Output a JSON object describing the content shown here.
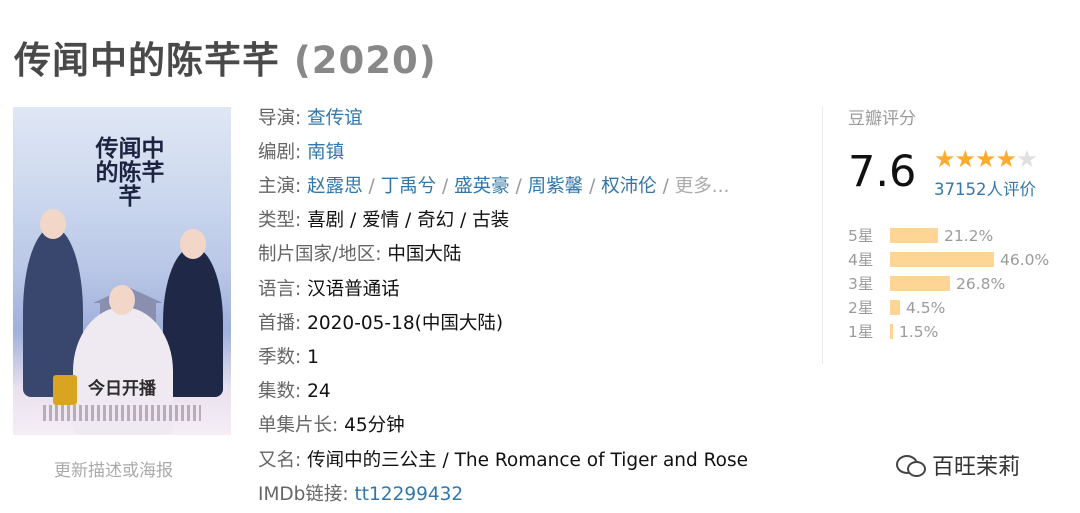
{
  "title": "传闻中的陈芊芊",
  "year": "(2020)",
  "poster": {
    "title_text": "传闻中的陈芊芊",
    "banner": "今日开播",
    "update_link": "更新描述或海报"
  },
  "info": {
    "director": {
      "label": "导演: ",
      "value": "查传谊"
    },
    "writer": {
      "label": "编剧: ",
      "value": "南镇"
    },
    "cast": {
      "label": "主演: ",
      "names": [
        "赵露思",
        "丁禹兮",
        "盛英豪",
        "周紫馨",
        "权沛伦"
      ],
      "more": "更多..."
    },
    "genre": {
      "label": "类型: ",
      "value": "喜剧 / 爱情 / 奇幻 / 古装"
    },
    "country": {
      "label": "制片国家/地区: ",
      "value": "中国大陆"
    },
    "language": {
      "label": "语言: ",
      "value": "汉语普通话"
    },
    "premiere": {
      "label": "首播: ",
      "value": "2020-05-18(中国大陆)"
    },
    "seasons": {
      "label": "季数: ",
      "value": "1"
    },
    "episodes": {
      "label": "集数: ",
      "value": "24"
    },
    "runtime": {
      "label": "单集片长: ",
      "value": "45分钟"
    },
    "aka": {
      "label": "又名: ",
      "value": "传闻中的三公主 / The Romance of Tiger and Rose"
    },
    "imdb": {
      "label": "IMDb链接: ",
      "value": "tt12299432"
    }
  },
  "rating": {
    "header": "豆瓣评分",
    "score": "7.6",
    "stars_filled": 4,
    "stars_total": 5,
    "votes": "37152人评价",
    "distribution": [
      {
        "label": "5星",
        "percent": 21.2,
        "text": "21.2%"
      },
      {
        "label": "4星",
        "percent": 46.0,
        "text": "46.0%"
      },
      {
        "label": "3星",
        "percent": 26.8,
        "text": "26.8%"
      },
      {
        "label": "2星",
        "percent": 4.5,
        "text": "4.5%"
      },
      {
        "label": "1星",
        "percent": 1.5,
        "text": "1.5%"
      }
    ],
    "bar_color": "#ffd596",
    "star_color": "#ffac2d"
  },
  "watermark": "百旺茉莉",
  "colors": {
    "link": "#3377aa",
    "label": "#666666",
    "title": "#494949"
  }
}
